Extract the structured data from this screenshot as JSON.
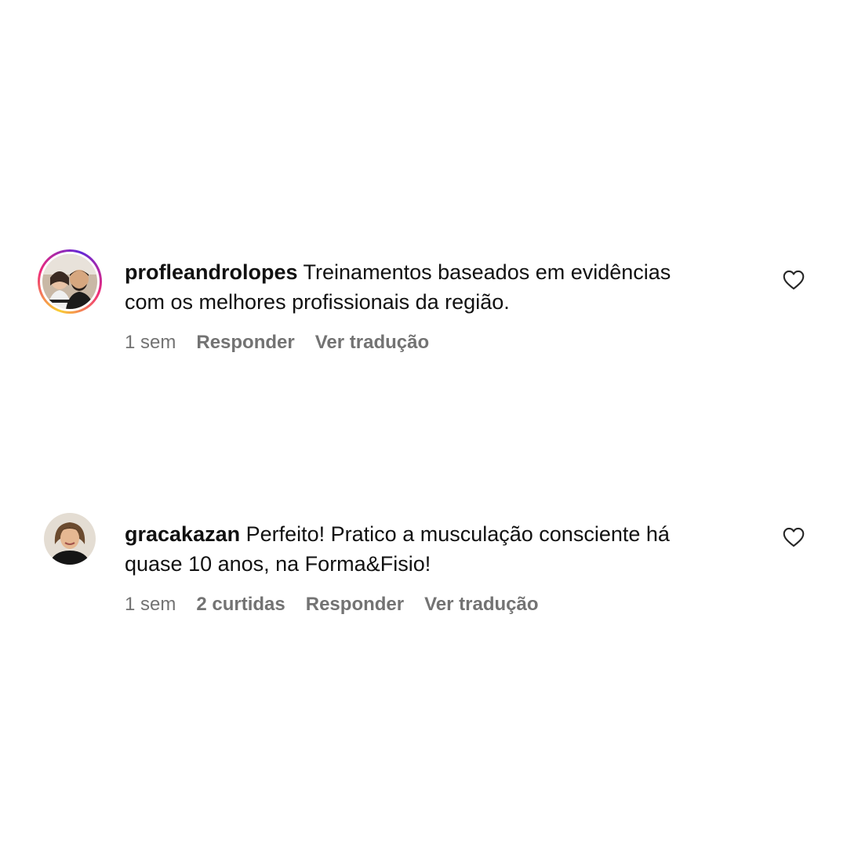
{
  "comments": [
    {
      "username": "profleandrolopes",
      "text": "Treinamentos baseados em evidências com os melhores profissionais da região.",
      "line1_text": "Treinamentos baseados em evidências",
      "line2_text": "com os melhores profissionais da região.",
      "time": "1 sem",
      "actions": [
        "Responder",
        "Ver tradução"
      ],
      "has_story_ring": true,
      "like_icon": "heart-outline-icon"
    },
    {
      "username": "gracakazan",
      "text": "Perfeito! Pratico a musculação consciente há quase 10 anos, na Forma&Fisio!",
      "line1_text": "Perfeito! Pratico a musculação consciente há",
      "line2_text": "quase 10 anos, na Forma&Fisio!",
      "time": "1 sem",
      "likes": "2 curtidas",
      "actions": [
        "Responder",
        "Ver tradução"
      ],
      "has_story_ring": false,
      "like_icon": "heart-outline-icon"
    }
  ],
  "colors": {
    "text": "#111111",
    "meta": "#737373",
    "background": "#ffffff",
    "ring_gradient": [
      "#f9ce34",
      "#ee2a7b",
      "#6228d7"
    ]
  }
}
